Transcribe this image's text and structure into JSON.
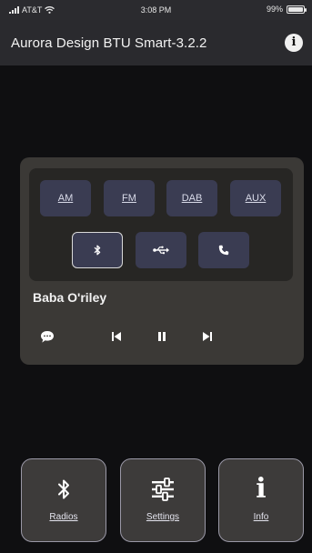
{
  "status_bar": {
    "carrier": "AT&T",
    "time": "3:08 PM",
    "battery": "99%",
    "battery_level": 0.99
  },
  "header": {
    "title": "Aurora Design BTU Smart-3.2.2",
    "info_icon": "info-circle-icon"
  },
  "player": {
    "sources": [
      "AM",
      "FM",
      "DAB",
      "AUX"
    ],
    "inputs": [
      {
        "name": "bluetooth",
        "icon": "bluetooth-icon",
        "selected": true
      },
      {
        "name": "usb",
        "icon": "usb-icon",
        "selected": false
      },
      {
        "name": "phone",
        "icon": "phone-icon",
        "selected": false
      }
    ],
    "track_title": "Baba O'riley",
    "controls": [
      "message-icon",
      "previous-icon",
      "pause-icon",
      "next-icon"
    ]
  },
  "bottom_nav": {
    "items": [
      {
        "label": "Radios",
        "icon": "bluetooth-icon"
      },
      {
        "label": "Settings",
        "icon": "sliders-icon"
      },
      {
        "label": "Info",
        "icon": "info-icon"
      }
    ]
  },
  "colors": {
    "background": "#0f0f11",
    "header": "#2a2a2e",
    "card": "#3b3936",
    "source_button": "#3a3c52"
  }
}
